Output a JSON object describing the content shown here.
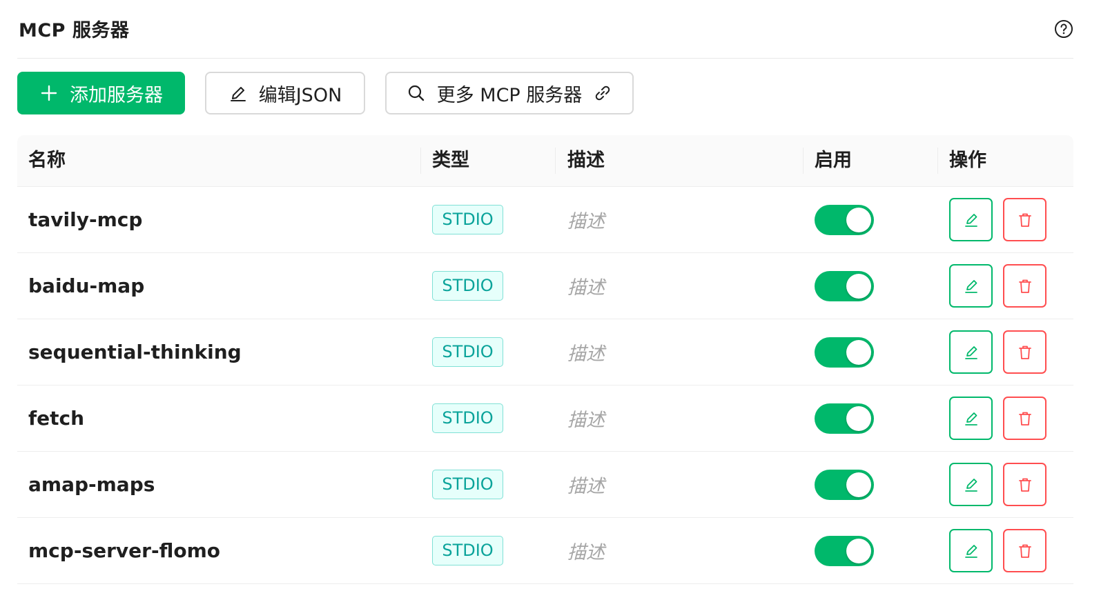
{
  "header": {
    "title": "MCP 服务器",
    "help_icon": "question-circle-icon"
  },
  "toolbar": {
    "add_label": "添加服务器",
    "add_icon": "plus-icon",
    "edit_json_label": "编辑JSON",
    "edit_json_icon": "pencil-icon",
    "more_label": "更多 MCP 服务器",
    "more_icon": "search-icon",
    "more_link_icon": "link-icon"
  },
  "table": {
    "columns": [
      "名称",
      "类型",
      "描述",
      "启用",
      "操作"
    ],
    "rows": [
      {
        "name": "tavily-mcp",
        "type": "STDIO",
        "description_placeholder": "描述",
        "enabled": true
      },
      {
        "name": "baidu-map",
        "type": "STDIO",
        "description_placeholder": "描述",
        "enabled": true
      },
      {
        "name": "sequential-thinking",
        "type": "STDIO",
        "description_placeholder": "描述",
        "enabled": true
      },
      {
        "name": "fetch",
        "type": "STDIO",
        "description_placeholder": "描述",
        "enabled": true
      },
      {
        "name": "amap-maps",
        "type": "STDIO",
        "description_placeholder": "描述",
        "enabled": true
      },
      {
        "name": "mcp-server-flomo",
        "type": "STDIO",
        "description_placeholder": "描述",
        "enabled": true
      }
    ]
  },
  "colors": {
    "primary": "#00b86b",
    "danger": "#ff4d4f",
    "tag_text": "#0aa39a",
    "tag_bg": "#e6fffb",
    "tag_border": "#7fe0d5"
  }
}
